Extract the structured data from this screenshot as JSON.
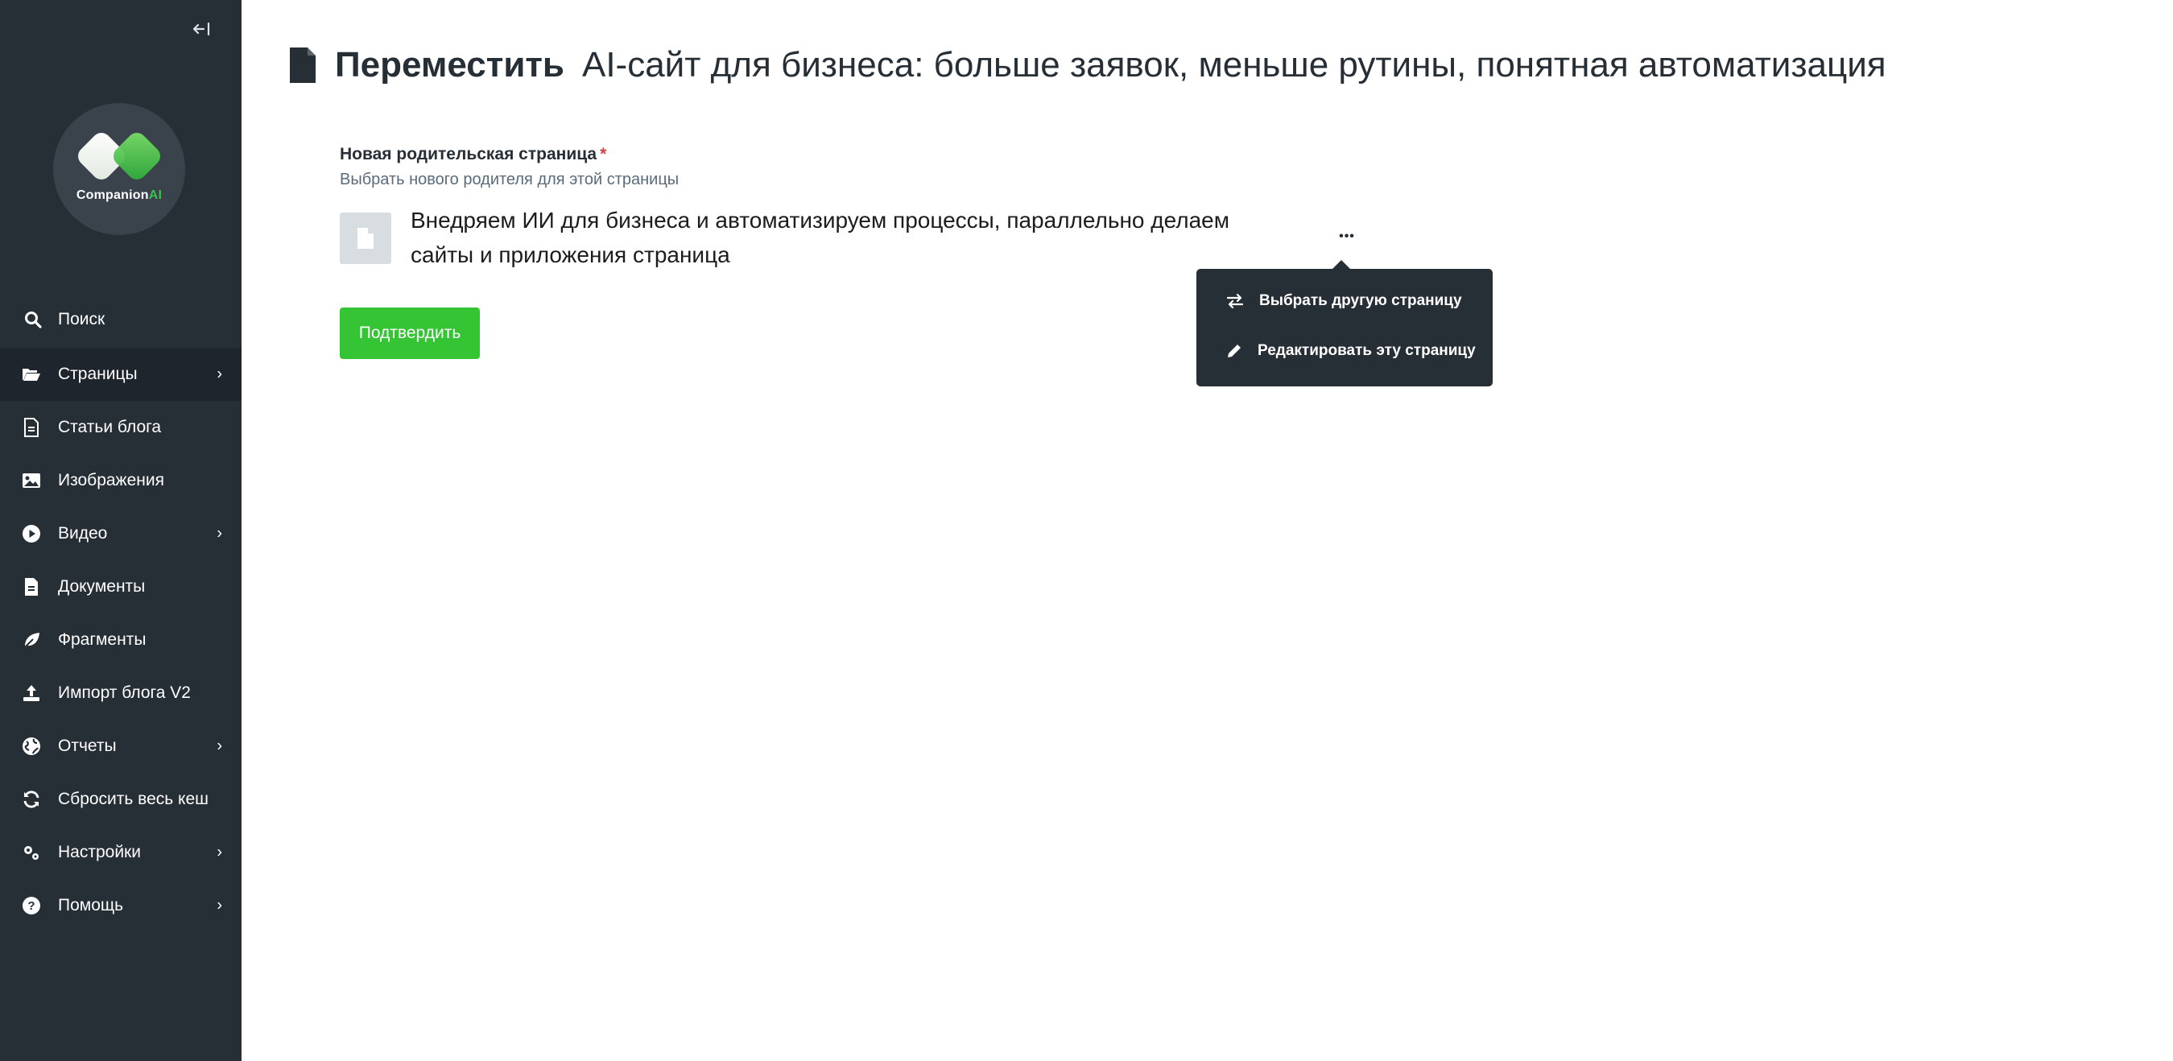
{
  "sidebar": {
    "collapse_glyph": "←|",
    "logo": {
      "brand_part1": "Companion",
      "brand_part2": "AI"
    },
    "search": {
      "label": "Поиск",
      "icon": "search-icon"
    },
    "items": [
      {
        "label": "Страницы",
        "icon": "folder-open-icon",
        "has_submenu": true,
        "active": true
      },
      {
        "label": "Статьи блога",
        "icon": "file-text-icon",
        "has_submenu": false
      },
      {
        "label": "Изображения",
        "icon": "image-icon",
        "has_submenu": false
      },
      {
        "label": "Видео",
        "icon": "play-circle-icon",
        "has_submenu": true
      },
      {
        "label": "Документы",
        "icon": "document-icon",
        "has_submenu": false
      },
      {
        "label": "Фрагменты",
        "icon": "leaf-icon",
        "has_submenu": false
      },
      {
        "label": "Импорт блога V2",
        "icon": "upload-icon",
        "has_submenu": false
      },
      {
        "label": "Отчеты",
        "icon": "globe-icon",
        "has_submenu": true
      },
      {
        "label": "Сбросить весь кеш",
        "icon": "refresh-icon",
        "has_submenu": false
      },
      {
        "label": "Настройки",
        "icon": "cogs-icon",
        "has_submenu": true
      },
      {
        "label": "Помощь",
        "icon": "help-circle-icon",
        "has_submenu": true
      }
    ],
    "chevron": "›"
  },
  "header": {
    "verb": "Переместить",
    "title": "AI-сайт для бизнеса: больше заявок, меньше рутины, понятная автоматизация"
  },
  "form": {
    "field_label": "Новая родительская страница",
    "required_mark": "*",
    "help_text": "Выбрать нового родителя для этой страницы",
    "selected_page_title": "Внедряем ИИ для бизнеса и автоматизируем процессы, параллельно делаем сайты и приложения страница",
    "more_glyph": "•••",
    "confirm_label": "Подтвердить"
  },
  "dropdown": {
    "items": [
      {
        "label": "Выбрать другую страницу",
        "icon": "swap-arrows-icon"
      },
      {
        "label": "Редактировать эту страницу",
        "icon": "pencil-icon"
      }
    ]
  },
  "colors": {
    "sidebar_bg": "#262e36",
    "sidebar_active_bg": "#1e252c",
    "accent_green": "#35c434",
    "required_red": "#cd4444",
    "dropdown_bg": "#262e36"
  }
}
